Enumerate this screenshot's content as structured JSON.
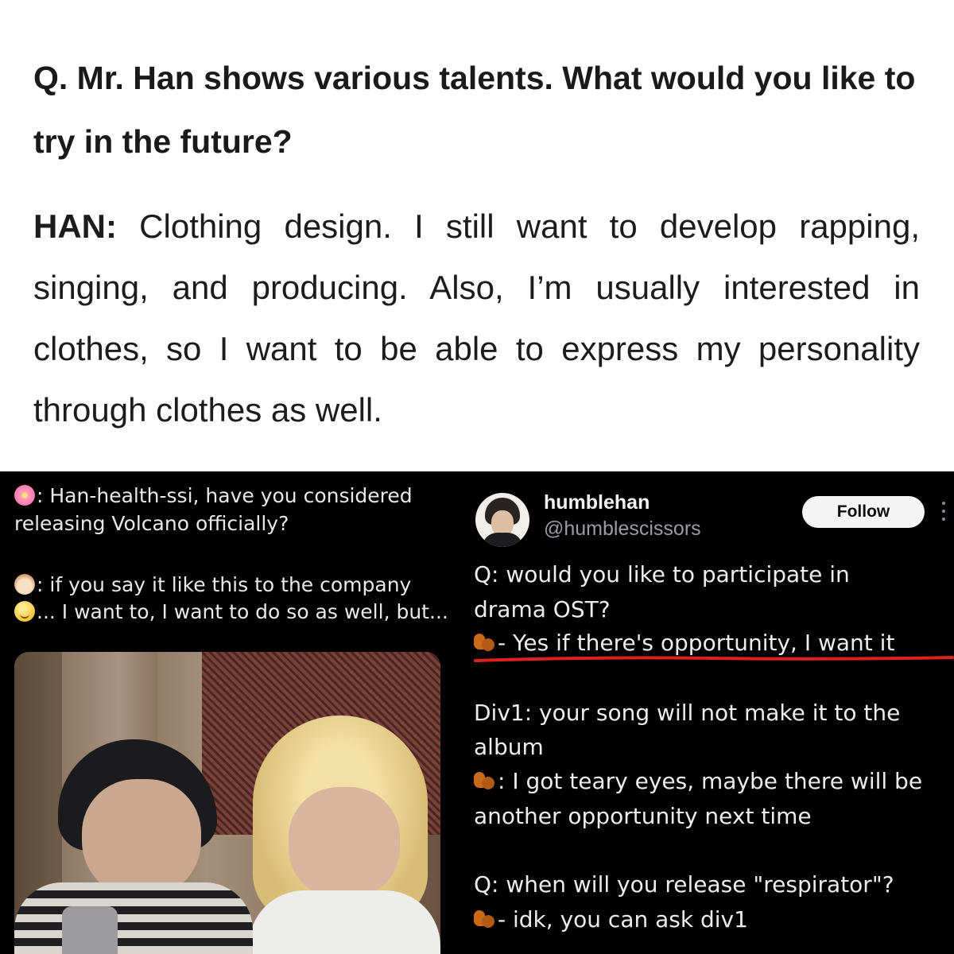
{
  "interview": {
    "question": "Q. Mr. Han shows various talents. What would you like to try in the future?",
    "speaker": "HAN:",
    "answer": "Clothing design. I still want to develop rapping, singing, and producing. Also, I’m usually interested in clothes, so I want to be able to express my personality through clothes as well."
  },
  "live_chat": {
    "line1": ": Han-health-ssi, have you considered",
    "line2": "releasing Volcano officially?",
    "line3": ": if you say it like this to the company",
    "line4": "... I want to, I want to do so as well, but...",
    "icons": [
      "flower-icon",
      "hamster-icon",
      "smile-icon"
    ]
  },
  "tweet": {
    "display_name": "humblehan",
    "handle": "@humblescissors",
    "follow_label": "Follow",
    "lines": [
      "Q: would you like to participate in",
      "drama OST?",
      "- Yes if there's opportunity, I want it",
      "Div1: your song will not make it to the",
      "album",
      ": I got teary eyes, maybe there will be",
      "another opportunity next time",
      "Q: when will you release \"respirator\"?",
      "- idk, you can ask div1"
    ],
    "underline_color": "#e0201c"
  }
}
